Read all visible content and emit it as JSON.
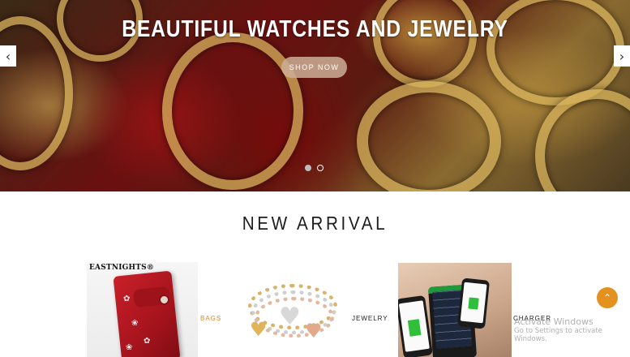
{
  "hero": {
    "title": "BEAUTIFUL WATCHES AND JEWELRY",
    "button_label": "SHOP NOW",
    "prev_arrow": "‹",
    "next_arrow": "›",
    "slides_total": 2,
    "active_slide": 1
  },
  "section": {
    "title": "NEW ARRIVAL"
  },
  "categories": [
    {
      "label": "BAGS",
      "image_brand": "EASTNIGHTS®",
      "active": true,
      "icon": "wallet-image"
    },
    {
      "label": "JEWELRY",
      "active": false,
      "icon": "bracelet-image"
    },
    {
      "label": "CHARGER",
      "active": false,
      "icon": "solar-charger-image"
    }
  ],
  "scroll_top": {
    "icon": "chevron-up-icon",
    "glyph": "⌃"
  },
  "watermark": {
    "line1": "Activate Windows",
    "line2": "Go to Settings to activate Windows."
  },
  "colors": {
    "accent": "#e3921f",
    "active_label": "#d98a2b",
    "text_dark": "#1d1d1d",
    "button_bg": "#cdaf96"
  }
}
